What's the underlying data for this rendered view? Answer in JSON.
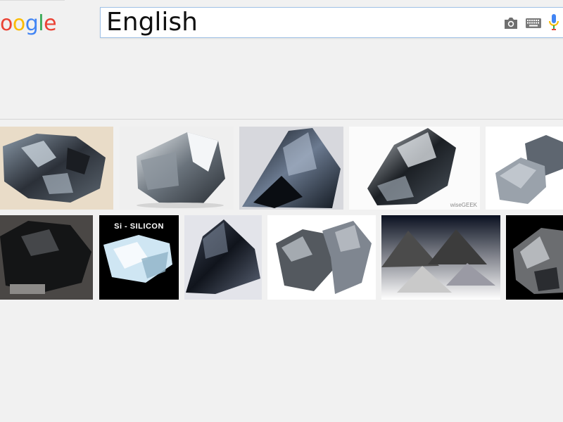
{
  "logo": {
    "partial_text": [
      "o",
      "o",
      "g",
      "l",
      "e"
    ],
    "colors": [
      "#ea4335",
      "#fbbc05",
      "#4285f4",
      "#34a853",
      "#ea4335"
    ]
  },
  "search": {
    "query": "English"
  },
  "icons": {
    "camera": "camera-icon",
    "keyboard": "keyboard-icon",
    "mic": "microphone-icon"
  },
  "results": {
    "tile_labels": {
      "silicon_badge": "Si  -  SILICON",
      "watermark": "wiseGEEK"
    }
  },
  "colors": {
    "accent_border": "#9fc1e6",
    "page_bg": "#f1f1f1"
  }
}
